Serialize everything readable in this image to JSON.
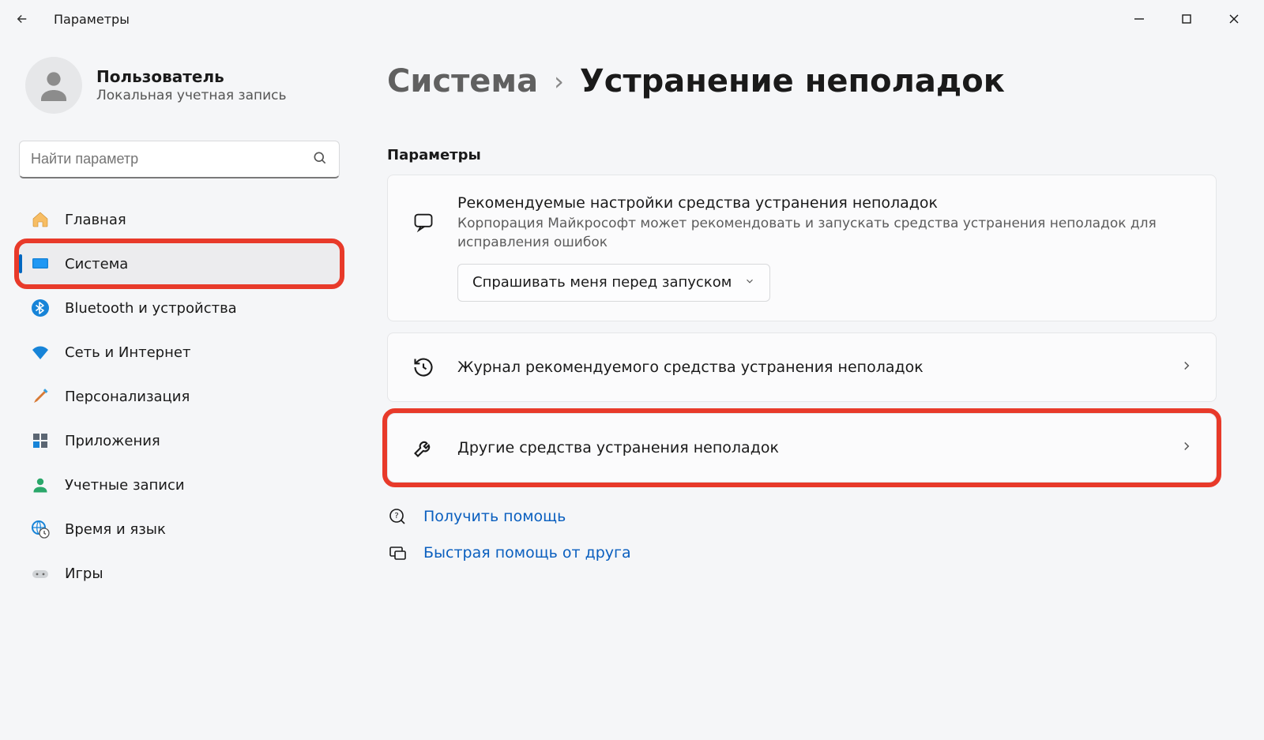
{
  "window": {
    "title": "Параметры"
  },
  "user": {
    "name": "Пользователь",
    "subtitle": "Локальная учетная запись"
  },
  "search": {
    "placeholder": "Найти параметр"
  },
  "sidebar": {
    "items": [
      {
        "label": "Главная",
        "icon": "home"
      },
      {
        "label": "Система",
        "icon": "system",
        "active": true,
        "highlighted": true
      },
      {
        "label": "Bluetooth и устройства",
        "icon": "bluetooth"
      },
      {
        "label": "Сеть и Интернет",
        "icon": "wifi"
      },
      {
        "label": "Персонализация",
        "icon": "brush"
      },
      {
        "label": "Приложения",
        "icon": "apps"
      },
      {
        "label": "Учетные записи",
        "icon": "account"
      },
      {
        "label": "Время и язык",
        "icon": "time"
      },
      {
        "label": "Игры",
        "icon": "games"
      }
    ]
  },
  "breadcrumb": {
    "parent": "Система",
    "current": "Устранение неполадок"
  },
  "section_label": "Параметры",
  "recommended": {
    "title": "Рекомендуемые настройки средства устранения неполадок",
    "subtitle": "Корпорация Майкрософт может рекомендовать и запускать средства устранения неполадок для исправления ошибок",
    "dropdown_value": "Спрашивать меня перед запуском"
  },
  "history_card": {
    "title": "Журнал рекомендуемого средства устранения неполадок"
  },
  "other_card": {
    "title": "Другие средства устранения неполадок"
  },
  "help": {
    "get_help": "Получить помощь",
    "quick_assist": "Быстрая помощь от друга"
  }
}
